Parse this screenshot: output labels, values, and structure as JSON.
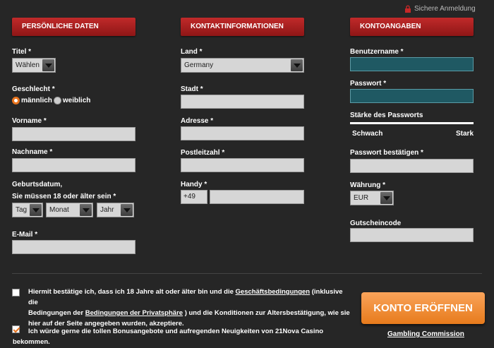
{
  "secure_login": "Sichere Anmeldung",
  "sections": {
    "personal": "PERSÖNLICHE DATEN",
    "contact": "KONTAKTINFORMATIONEN",
    "account": "KONTOANGABEN"
  },
  "personal": {
    "title_label": "Titel *",
    "title_value": "Wählen",
    "gender_label": "Geschlecht *",
    "gender_male": "männlich",
    "gender_female": "weiblich",
    "gender_selected": "männlich",
    "firstname_label": "Vorname *",
    "lastname_label": "Nachname *",
    "birth_label1": "Geburtsdatum,",
    "birth_label2": "Sie müssen 18 oder älter sein *",
    "day": "Tag",
    "month": "Monat",
    "year": "Jahr",
    "email_label": "E-Mail *"
  },
  "contact": {
    "country_label": "Land *",
    "country_value": "Germany",
    "city_label": "Stadt *",
    "address_label": "Adresse *",
    "zip_label": "Postleitzahl *",
    "mobile_label": "Handy *",
    "mobile_prefix": "+49"
  },
  "account": {
    "username_label": "Benutzername *",
    "password_label": "Passwort *",
    "strength_label": "Stärke des Passworts",
    "weak": "Schwach",
    "strong": "Stark",
    "confirm_label": "Passwort bestätigen *",
    "currency_label": "Währung *",
    "currency_value": "EUR",
    "voucher_label": "Gutscheincode"
  },
  "terms": {
    "t1": "Hiermit bestätige ich, dass ich 18 Jahre alt oder älter bin und die ",
    "t1_link": "Geschäftsbedingungen",
    "t2": " (inklusive die",
    "t3": "Bedingungen der ",
    "t3_link": "Bedingungen der Privatsphäre",
    "t4": " ) und die Konditionen zur Altersbestätigung, wie sie",
    "t5": "hier auf der Seite angegeben wurden, akzeptiere.",
    "terms_checked": false,
    "bonus1": "Ich würde gerne die tollen Bonusangebote und aufregenden Neuigkeiten von 21Nova Casino",
    "bonus2": "bekommen.",
    "bonus_checked": true
  },
  "cta_label": "KONTO ERÖFFNEN",
  "gambling_link": "Gambling Commission",
  "colors": {
    "background": "#262626",
    "header_red": "#a81f1f",
    "accent_orange": "#e8731c",
    "input_gray": "#d6d6d6",
    "input_teal": "#1f5963"
  }
}
